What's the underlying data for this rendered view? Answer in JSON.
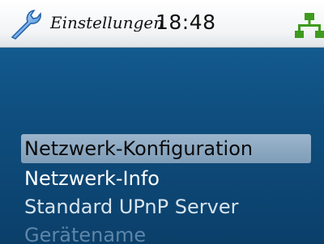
{
  "status_bar": {
    "title": "Einstellungen",
    "time": "18:48",
    "icons": {
      "settings": "wrench-icon",
      "network": "network-icon"
    }
  },
  "menu": {
    "items": [
      {
        "label": "Netzwerk-Konfiguration",
        "selected": true
      },
      {
        "label": "Netzwerk-Info",
        "selected": false
      },
      {
        "label": "Standard UPnP Server",
        "selected": false
      },
      {
        "label": "Gerätename",
        "selected": false
      }
    ]
  },
  "colors": {
    "background": "#0f4f80",
    "highlight": "#8aa6bf",
    "network_icon": "#3f9a1f"
  }
}
